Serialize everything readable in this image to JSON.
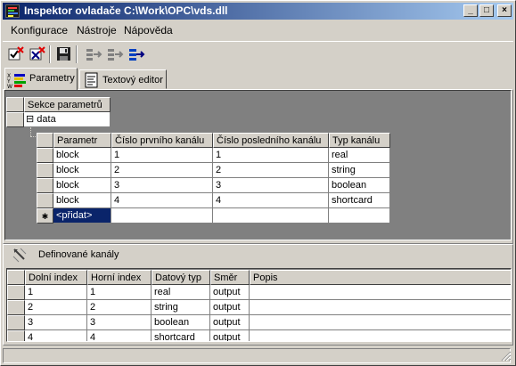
{
  "window": {
    "title": "Inspektor ovladače C:\\Work\\OPC\\vds.dll",
    "minimize_label": "_",
    "maximize_label": "□",
    "close_label": "×"
  },
  "menu": {
    "items": [
      {
        "label": "Konfigurace"
      },
      {
        "label": "Nástroje"
      },
      {
        "label": "Nápověda"
      }
    ]
  },
  "tabs": [
    {
      "label": "Parametry"
    },
    {
      "label": "Textový editor"
    }
  ],
  "params": {
    "section_header": "Sekce parametrů",
    "tree_node_toggle": "⊟",
    "tree_node": "data",
    "columns": [
      "Parametr",
      "Číslo prvního kanálu",
      "Číslo posledního kanálu",
      "Typ kanálu"
    ],
    "rows": [
      [
        "block",
        "1",
        "1",
        "real"
      ],
      [
        "block",
        "2",
        "2",
        "string"
      ],
      [
        "block",
        "3",
        "3",
        "boolean"
      ],
      [
        "block",
        "4",
        "4",
        "shortcard"
      ]
    ],
    "new_row_marker": "✱",
    "new_row_label": "<přidat>"
  },
  "channels": {
    "title": "Definované kanály",
    "columns": [
      "Dolní index",
      "Horní index",
      "Datový typ",
      "Směr",
      "Popis"
    ],
    "rows": [
      [
        "1",
        "1",
        "real",
        "output",
        ""
      ],
      [
        "2",
        "2",
        "string",
        "output",
        ""
      ],
      [
        "3",
        "3",
        "boolean",
        "output",
        ""
      ],
      [
        "4",
        "4",
        "shortcard",
        "output",
        ""
      ]
    ]
  },
  "colors": {
    "titlebar_start": "#0a246a",
    "titlebar_end": "#a6caf0",
    "selection": "#0a246a",
    "face": "#d4d0c8",
    "grid_background": "#808080"
  },
  "icons": {
    "app": "app-icon",
    "toolbar": [
      "check-red-x-icon",
      "blue-x-icon",
      "floppy-save-icon",
      "import-icon",
      "export-icon",
      "move-right-icon"
    ],
    "tab_parametry": "xyz-bars-icon",
    "tab_editor": "text-document-icon",
    "channels": "tool-wrench-icon"
  }
}
